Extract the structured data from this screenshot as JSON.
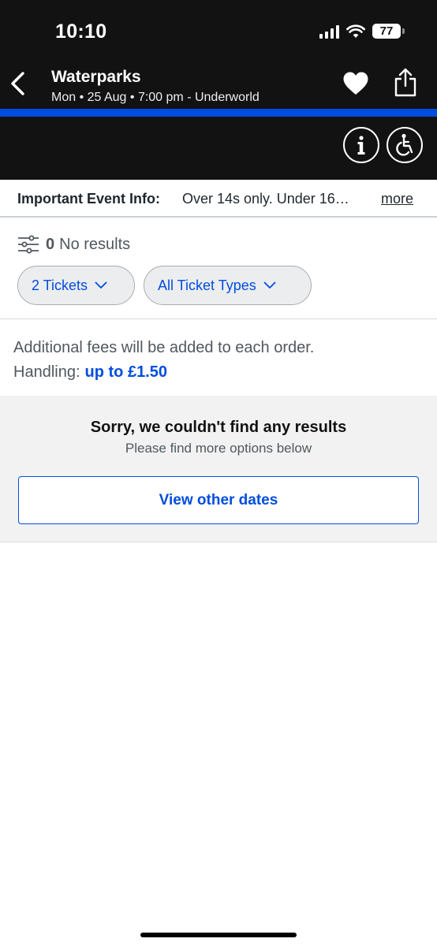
{
  "status_bar": {
    "time": "10:10",
    "battery": "77",
    "icons": [
      "signal-icon",
      "wifi-icon",
      "battery-icon"
    ]
  },
  "header": {
    "title": "Waterparks",
    "subtitle": "Mon • 25 Aug • 7:00 pm - Underworld",
    "icons": [
      "back-chevron-icon",
      "heart-icon",
      "share-icon",
      "info-icon",
      "accessibility-icon"
    ]
  },
  "important_info": {
    "label": "Important Event Info:",
    "text": "Over 14s only. Under 16…",
    "more": "more"
  },
  "filters": {
    "count": "0",
    "results_label": "No results",
    "tickets_label": "2 Tickets",
    "ticket_types_label": "All Ticket Types"
  },
  "fees": {
    "line1": "Additional fees will be added to each order.",
    "handling_label": "Handling:",
    "handling_value": "up to £1.50"
  },
  "no_results": {
    "title": "Sorry, we couldn't find any results",
    "subtitle": "Please find more options below",
    "button_label": "View other dates"
  },
  "colors": {
    "header_bg": "#121212",
    "accent_blue": "#024ddf",
    "text_grey": "#50585f",
    "panel_bg": "#f2f2f2"
  }
}
